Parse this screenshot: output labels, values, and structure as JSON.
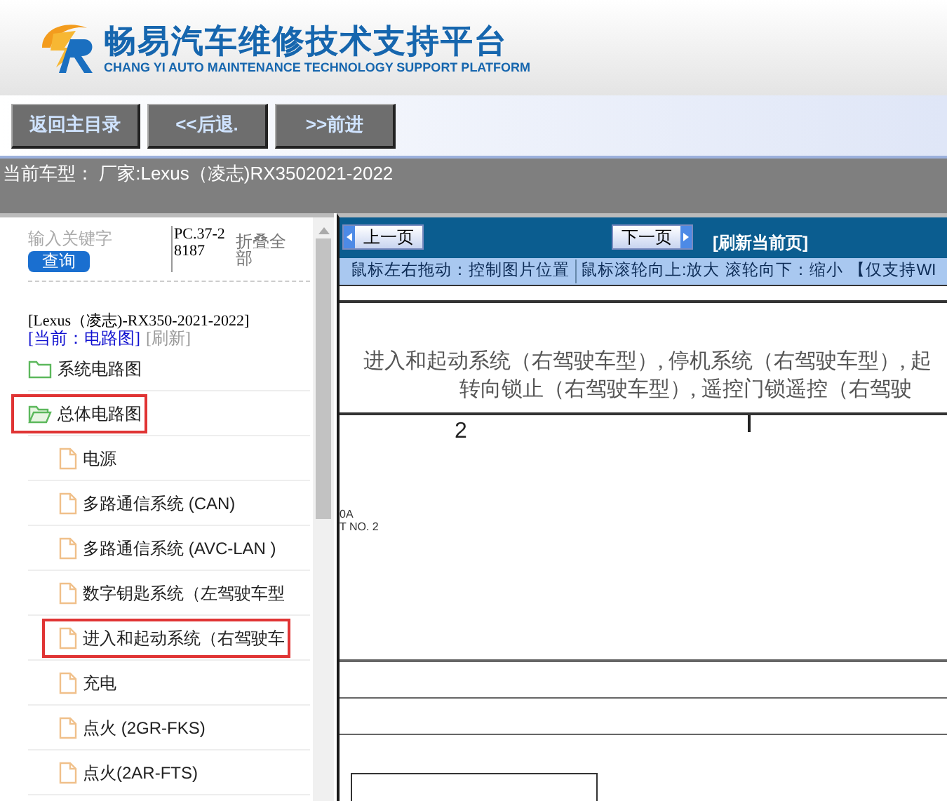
{
  "header": {
    "title": "畅易汽车维修技术支持平台",
    "subtitle": "CHANG YI AUTO MAINTENANCE TECHNOLOGY SUPPORT PLATFORM"
  },
  "nav_buttons": [
    "返回主目录",
    "<<后退.",
    ">>前进"
  ],
  "current_vehicle": "当前车型： 厂家:Lexus（凌志)RX3502021-2022",
  "sidebar": {
    "search": {
      "placeholder": "输入关键字"
    },
    "search_button": "查询",
    "code": "PC.37-28187",
    "collapse_all": "折叠全部",
    "vehicle": "[Lexus（凌志)-RX350-2021-2022]",
    "current": "[当前：电路图]",
    "refresh": "[刷新]",
    "tree": [
      {
        "label": "系统电路图",
        "kind": "folder",
        "expanded": false,
        "selected": false
      },
      {
        "label": "总体电路图",
        "kind": "folder",
        "expanded": true,
        "selected": true,
        "children": [
          {
            "label": "电源",
            "kind": "page",
            "selected": false
          },
          {
            "label": "多路通信系统 (CAN)",
            "kind": "page",
            "selected": false
          },
          {
            "label": "多路通信系统 (AVC-LAN )",
            "kind": "page",
            "selected": false
          },
          {
            "label": "数字钥匙系统（左驾驶车型",
            "kind": "page",
            "selected": false
          },
          {
            "label": "进入和起动系统（右驾驶车",
            "kind": "page",
            "selected": true
          },
          {
            "label": "充电",
            "kind": "page",
            "selected": false
          },
          {
            "label": "点火 (2GR-FKS)",
            "kind": "page",
            "selected": false
          },
          {
            "label": "点火(2AR-FTS)",
            "kind": "page",
            "selected": false
          }
        ]
      }
    ]
  },
  "viewer": {
    "prev_button": "上一页",
    "next_button": "下一页",
    "refresh_page": "[刷新当前页]",
    "hints": [
      "鼠标左右拖动：控制图片位置",
      "鼠标滚轮向上:放大",
      "滚轮向下：缩小",
      "【仅支持WI"
    ],
    "diagram": {
      "title_lines": [
        "进入和起动系统（右驾驶车型）, 停机系统（右驾驶车型）, 起",
        "转向锁止（右驾驶车型）, 遥控门锁遥控（右驾驶"
      ],
      "labels": [
        "2",
        "0A",
        "T NO. 2"
      ]
    }
  }
}
